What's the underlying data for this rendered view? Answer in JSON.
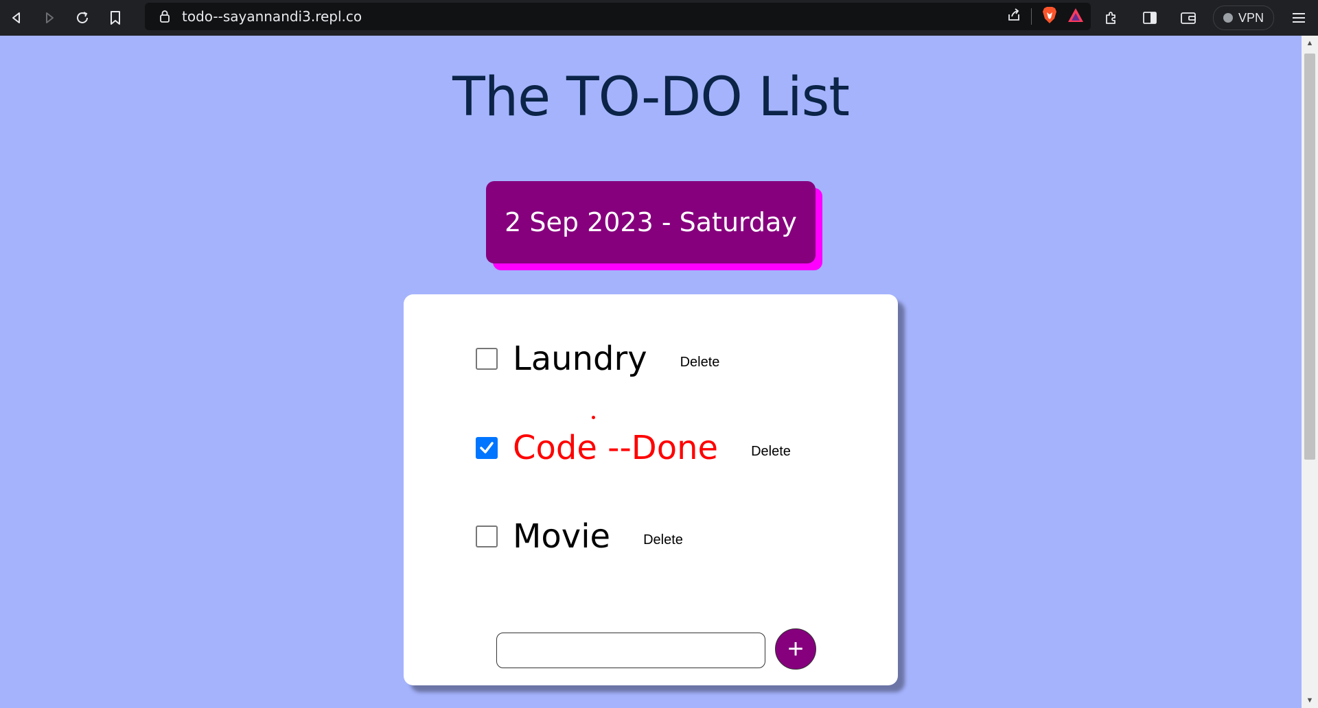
{
  "browser": {
    "url": "todo--sayannandi3.repl.co",
    "vpn_label": "VPN"
  },
  "page": {
    "title": "The TO-DO List",
    "date": "2 Sep 2023 - Saturday"
  },
  "todos": [
    {
      "label": "Laundry",
      "checked": false,
      "delete_label": "Delete"
    },
    {
      "label": "Code --Done",
      "checked": true,
      "delete_label": "Delete"
    },
    {
      "label": "Movie",
      "checked": false,
      "delete_label": "Delete"
    }
  ],
  "new_item": {
    "placeholder": "",
    "value": "",
    "add_button_label": "+"
  },
  "colors": {
    "background": "#a5b3fd",
    "title": "#0b2447",
    "accent": "#86007d",
    "accent_shadow": "#ff00ff",
    "done_text": "#ff0000",
    "checkbox_checked": "#0075ff"
  }
}
